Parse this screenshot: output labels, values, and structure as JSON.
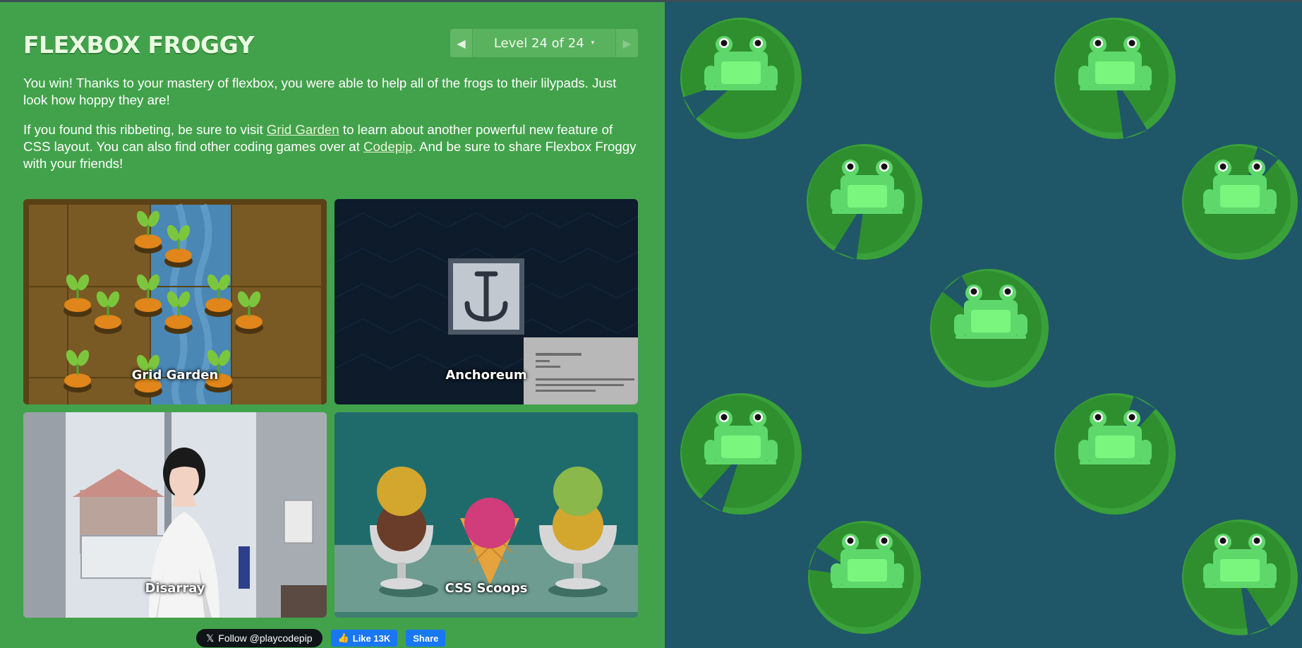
{
  "header": {
    "title": "FLEXBOX FROGGY",
    "level_label": "Level 24 of 24",
    "prev_icon": "◀",
    "next_icon": "▶",
    "caret_icon": "▾"
  },
  "instructions": {
    "para1": "You win! Thanks to your mastery of flexbox, you were able to help all of the frogs to their lilypads. Just look how hoppy they are!",
    "para2_before": "If you found this ribbeting, be sure to visit ",
    "grid_garden_link": "Grid Garden",
    "para2_middle": " to learn about another powerful new feature of CSS layout. You can also find other coding games over at ",
    "codepip_link": "Codepip",
    "para2_after": ". And be sure to share Flexbox Froggy with your friends!"
  },
  "games": [
    {
      "label": "Grid Garden"
    },
    {
      "label": "Anchoreum"
    },
    {
      "label": "Disarray"
    },
    {
      "label": "CSS Scoops"
    }
  ],
  "social": {
    "x_icon": "𝕏",
    "x_follow": "Follow @playcodepip",
    "fb_icon": "👍",
    "fb_like": "Like 13K",
    "fb_share": "Share"
  },
  "colors": {
    "sidebar": "#42a24b",
    "pond": "#1f5768",
    "lilypad": "#2f8f2f",
    "lilypad_rim": "#3aa13a",
    "frog": "#5fd86b",
    "frog_belly": "#7af57e"
  },
  "pond": {
    "frog_count": 9,
    "lilypad_count": 9
  }
}
